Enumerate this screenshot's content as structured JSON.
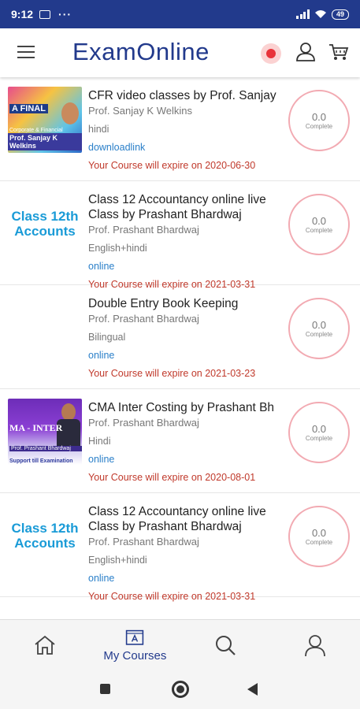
{
  "status_bar": {
    "time": "9:12",
    "dots": "···",
    "battery": "49"
  },
  "header": {
    "title": "ExamOnline"
  },
  "courses": [
    {
      "title": "CFR video classes by Prof. Sanjay",
      "professor": "Prof. Sanjay K Welkins",
      "language": "hindi",
      "mode": "downloadlink",
      "expiry": "Your Course will expire on 2020-06-30",
      "progress_value": "0.0",
      "progress_label": "Complete",
      "thumb": {
        "line1": "A FINAL",
        "line2": "Corporate & Financial Reporting",
        "line3": "Prof. Sanjay K Welkins"
      }
    },
    {
      "title": "Class 12 Accountancy online live Class by Prashant Bhardwaj",
      "professor": "Prof. Prashant Bhardwaj",
      "language": "English+hindi",
      "mode": "online",
      "expiry": "Your Course will expire on 2021-03-31",
      "progress_value": "0.0",
      "progress_label": "Complete",
      "thumb": {
        "line1": "Class 12th",
        "line2": "Accounts"
      }
    },
    {
      "title": "Double Entry Book Keeping",
      "professor": "Prof. Prashant Bhardwaj",
      "language": "Bilingual",
      "mode": "online",
      "expiry": "Your Course will expire on 2021-03-23",
      "progress_value": "0.0",
      "progress_label": "Complete"
    },
    {
      "title": "CMA Inter Costing by Prashant Bh",
      "professor": "Prof. Prashant Bhardwaj",
      "language": "Hindi",
      "mode": "online",
      "expiry": "Your Course will expire on 2020-08-01",
      "progress_value": "0.0",
      "progress_label": "Complete",
      "thumb": {
        "line1": "MA - INTER",
        "line2": "Prof. Prashant Bhardwaj",
        "line3": "Support till Examination"
      }
    },
    {
      "title": "Class 12 Accountancy online live Class by Prashant Bhardwaj",
      "professor": "Prof. Prashant Bhardwaj",
      "language": "English+hindi",
      "mode": "online",
      "expiry": "Your Course will expire on 2021-03-31",
      "progress_value": "0.0",
      "progress_label": "Complete",
      "thumb": {
        "line1": "Class 12th",
        "line2": "Accounts"
      }
    }
  ],
  "bottom_nav": {
    "items": [
      {
        "icon": "home-icon",
        "label": ""
      },
      {
        "icon": "courses-icon",
        "label": "My Courses",
        "active": true
      },
      {
        "icon": "search-icon",
        "label": ""
      },
      {
        "icon": "profile-icon",
        "label": ""
      }
    ]
  },
  "colors": {
    "brand": "#223a8c",
    "expiry": "#c0392b",
    "link": "#2a7fc9",
    "ring": "#f2aab2"
  }
}
